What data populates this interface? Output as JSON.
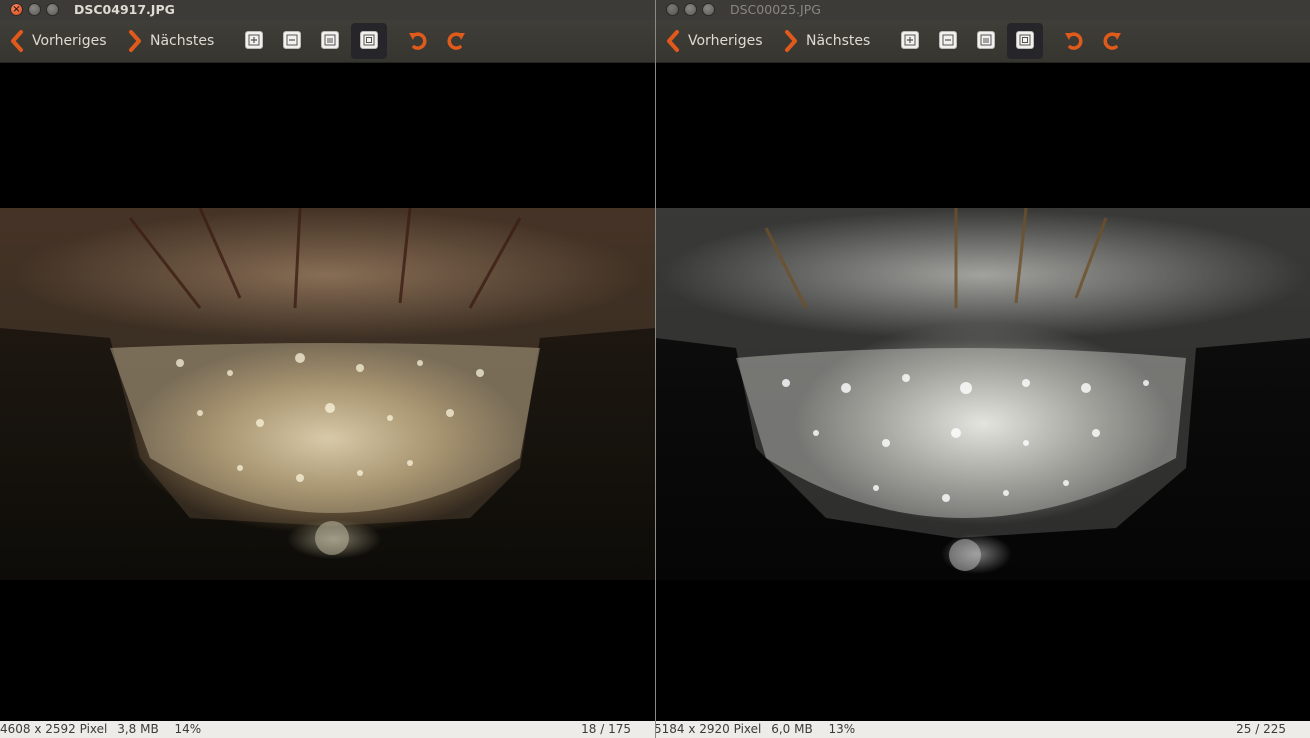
{
  "windows": [
    {
      "title": "DSC04917.JPG",
      "active": true,
      "toolbar": {
        "prev_label": "Vorheriges",
        "next_label": "Nächstes"
      },
      "status": {
        "dimensions": "4608 x 2592 Pixel",
        "filesize": "3,8 MB",
        "zoom": "14%",
        "position": "18 / 175"
      },
      "icons": {
        "prev": "chevron-left-icon",
        "next": "chevron-right-icon",
        "rotate_ccw": "rotate-left-icon",
        "rotate_cw": "rotate-right-icon"
      }
    },
    {
      "title": "DSC00025.JPG",
      "active": false,
      "toolbar": {
        "prev_label": "Vorheriges",
        "next_label": "Nächstes"
      },
      "status": {
        "dimensions": "5184 x 2920 Pixel",
        "filesize": "6,0 MB",
        "zoom": "13%",
        "position": "25 / 225"
      },
      "icons": {
        "prev": "chevron-left-icon",
        "next": "chevron-right-icon",
        "rotate_ccw": "rotate-left-icon",
        "rotate_cw": "rotate-right-icon"
      }
    }
  ],
  "colors": {
    "accent": "#e05a1c",
    "toolbar_bg": "#3c3b37",
    "status_bg": "#edece8",
    "viewer_bg": "#000000"
  }
}
